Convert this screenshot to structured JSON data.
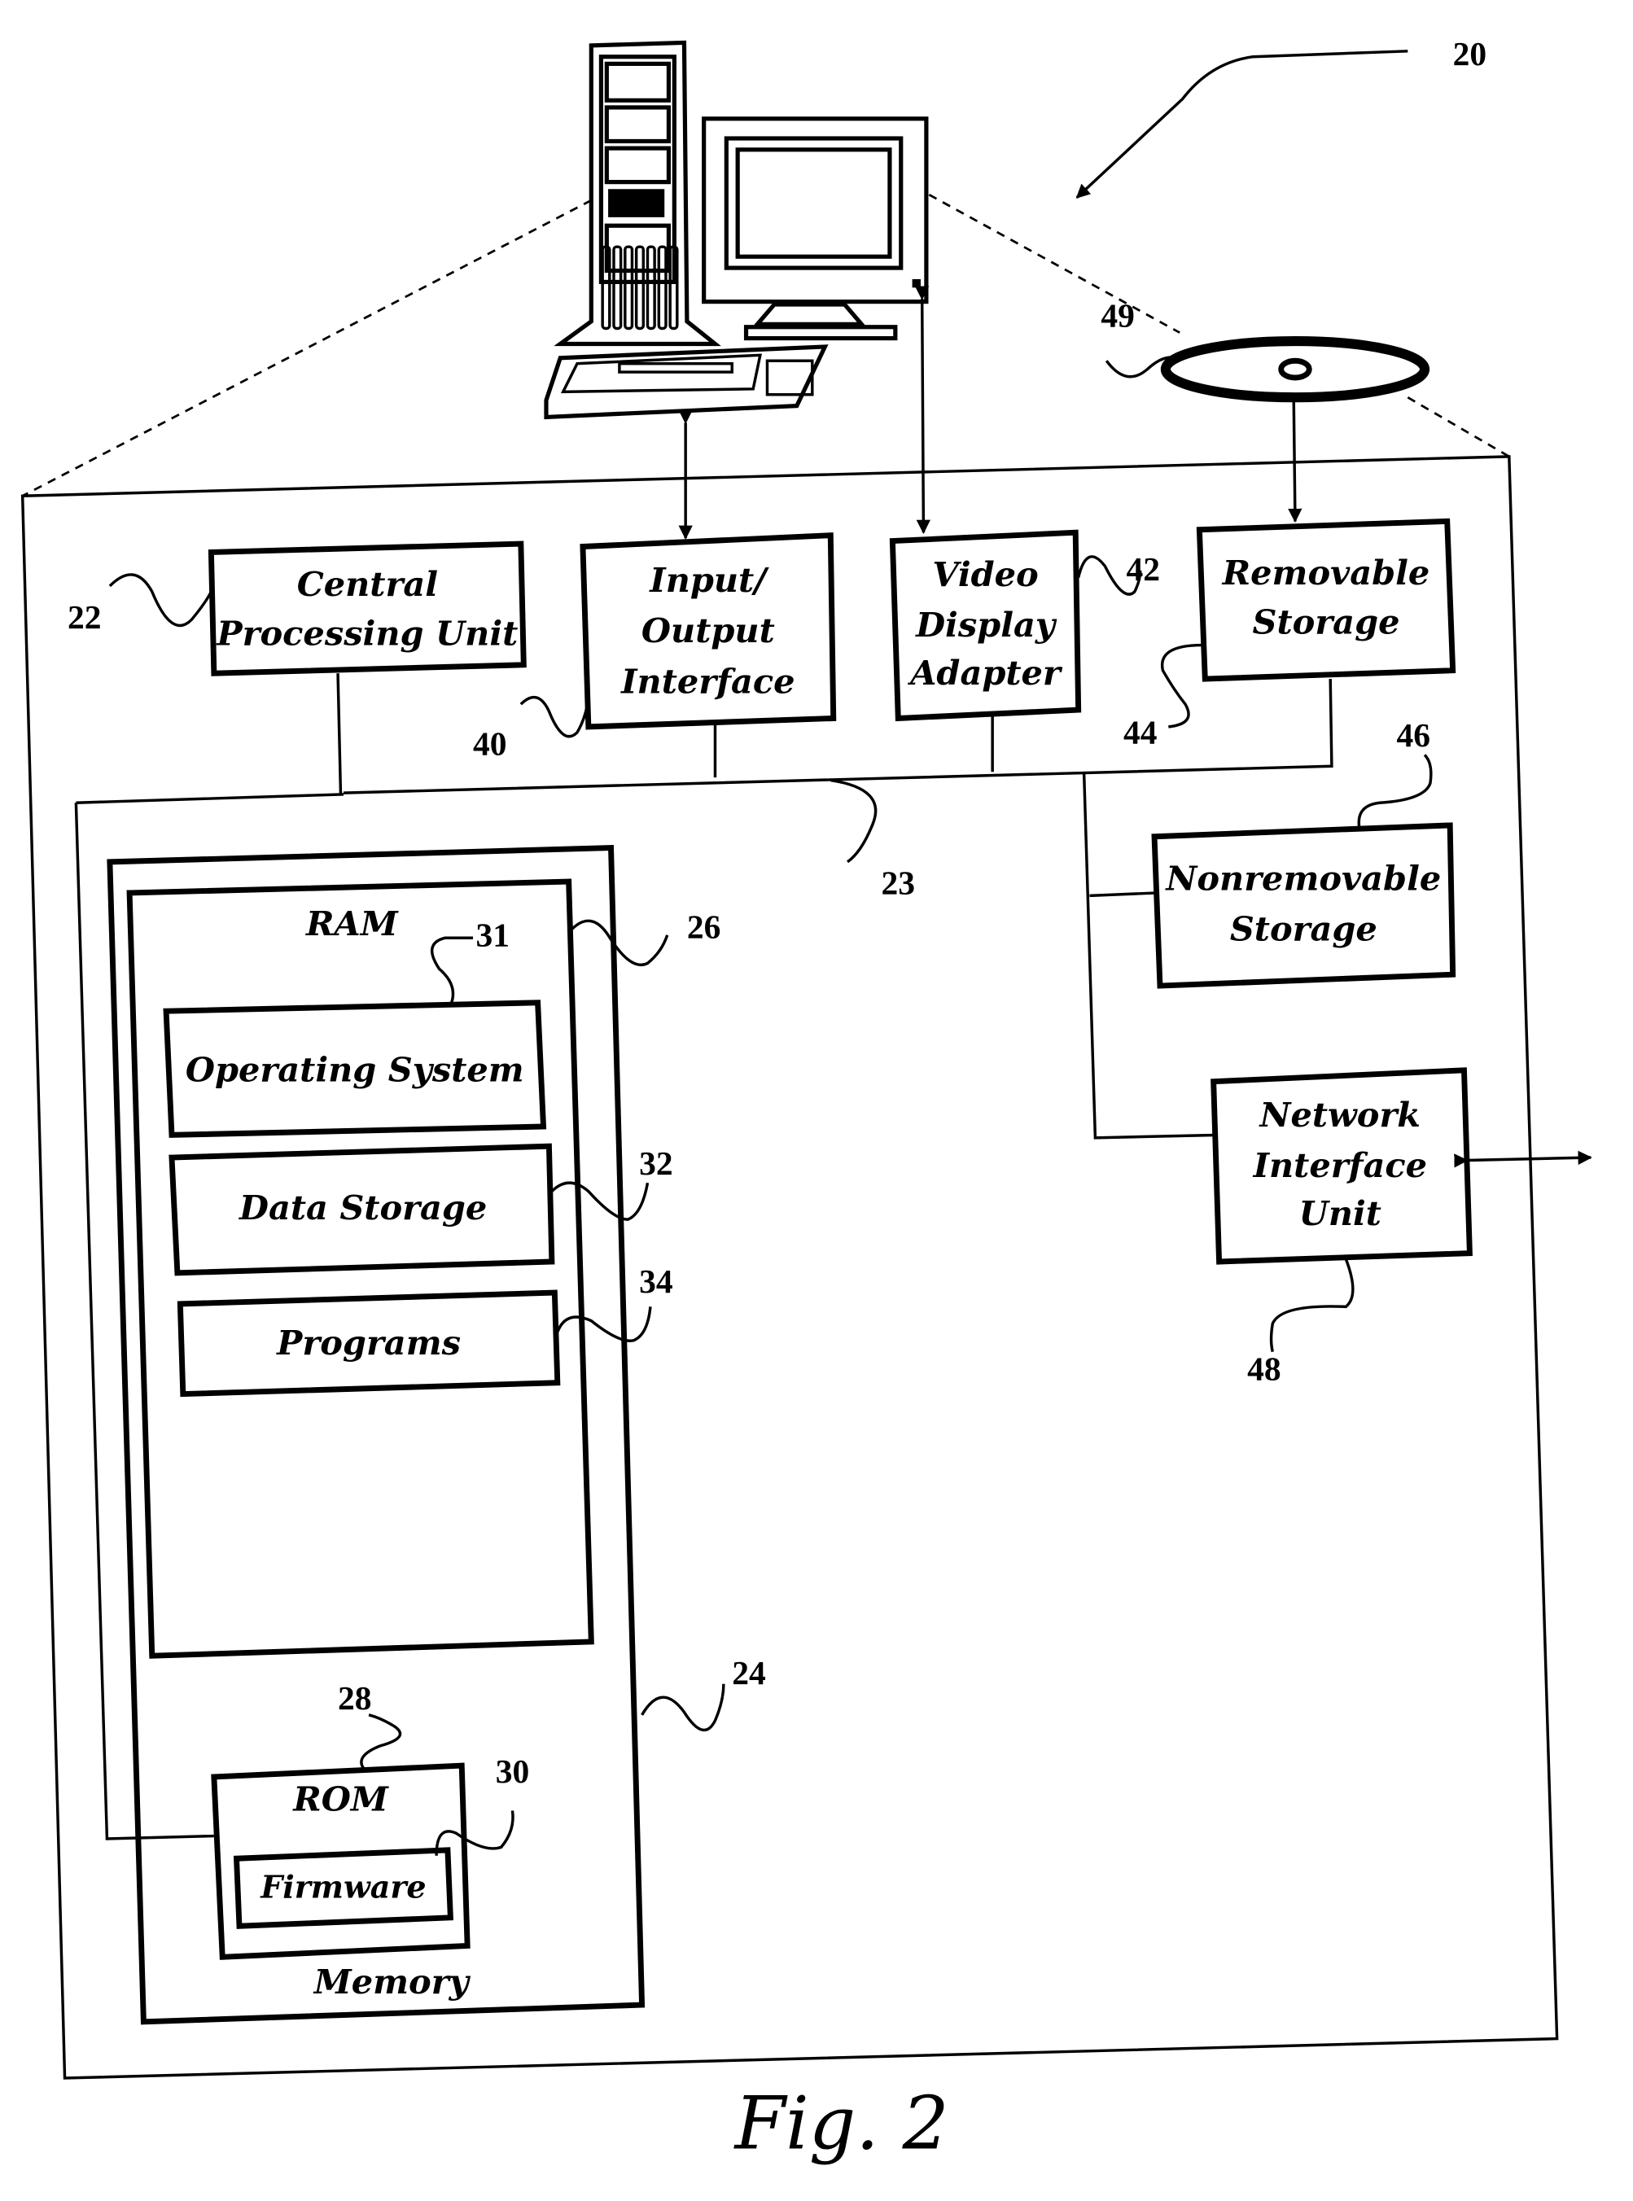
{
  "figure": {
    "caption": "Fig. 2",
    "system_ref": "20",
    "colors": {
      "ink": "#000000",
      "background": "#ffffff"
    }
  },
  "components": {
    "cpu": {
      "lines": [
        "Central",
        "Processing Unit"
      ],
      "ref": "22"
    },
    "io": {
      "lines": [
        "Input/",
        "Output",
        "Interface"
      ],
      "ref": "40"
    },
    "video": {
      "lines": [
        "Video",
        "Display",
        "Adapter"
      ],
      "ref": "42"
    },
    "removable": {
      "lines": [
        "Removable",
        "Storage"
      ],
      "ref": "44"
    },
    "nonremovable": {
      "lines": [
        "Nonremovable",
        "Storage"
      ],
      "ref": "46"
    },
    "network": {
      "lines": [
        "Network",
        "Interface",
        "Unit"
      ],
      "ref": "48"
    },
    "bus": {
      "ref": "23"
    },
    "disc": {
      "ref": "49"
    },
    "memory": {
      "label": "Memory",
      "ref": "24"
    },
    "ram": {
      "label": "RAM",
      "ref": "26"
    },
    "os": {
      "label": "Operating System",
      "ref": "31"
    },
    "data_storage": {
      "label": "Data Storage",
      "ref": "32"
    },
    "programs": {
      "label": "Programs",
      "ref": "34"
    },
    "rom": {
      "label": "ROM",
      "ref": "28"
    },
    "firmware": {
      "label": "Firmware",
      "ref": "30"
    }
  }
}
